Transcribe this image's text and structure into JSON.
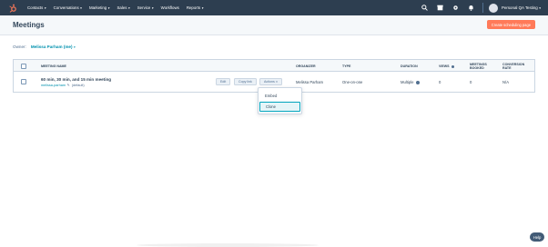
{
  "nav": {
    "items": [
      {
        "label": "Contacts"
      },
      {
        "label": "Conversations"
      },
      {
        "label": "Marketing"
      },
      {
        "label": "Sales"
      },
      {
        "label": "Service"
      },
      {
        "label": "Workflows"
      },
      {
        "label": "Reports"
      }
    ],
    "account_label": "Personal QA Testing",
    "brand_color": "#ff7a59",
    "bar_color": "#2d3e50"
  },
  "header": {
    "title": "Meetings",
    "create_button": "Create scheduling page"
  },
  "owner": {
    "label": "Owner:",
    "value": "Melissa Parham (me)"
  },
  "table": {
    "headers": {
      "name": "Meeting name",
      "organizer": "Organizer",
      "type": "Type",
      "duration": "Duration",
      "views": "Views",
      "booked": "Meetings booked",
      "conversion": "Conversion rate"
    },
    "row": {
      "name": "60 min, 30 min, and 15 min meeting",
      "link": "melissa-parham",
      "link_suffix": "(default)",
      "edit": "Edit",
      "copy": "Copy link",
      "actions": "Actions",
      "organizer": "Melissa Parham",
      "type": "One-on-one",
      "duration": "Multiple",
      "views": "0",
      "booked": "0",
      "conversion": "N/A"
    }
  },
  "dropdown": {
    "items": [
      "Embed",
      "Clone"
    ],
    "selected": "Clone"
  },
  "help": "Help"
}
